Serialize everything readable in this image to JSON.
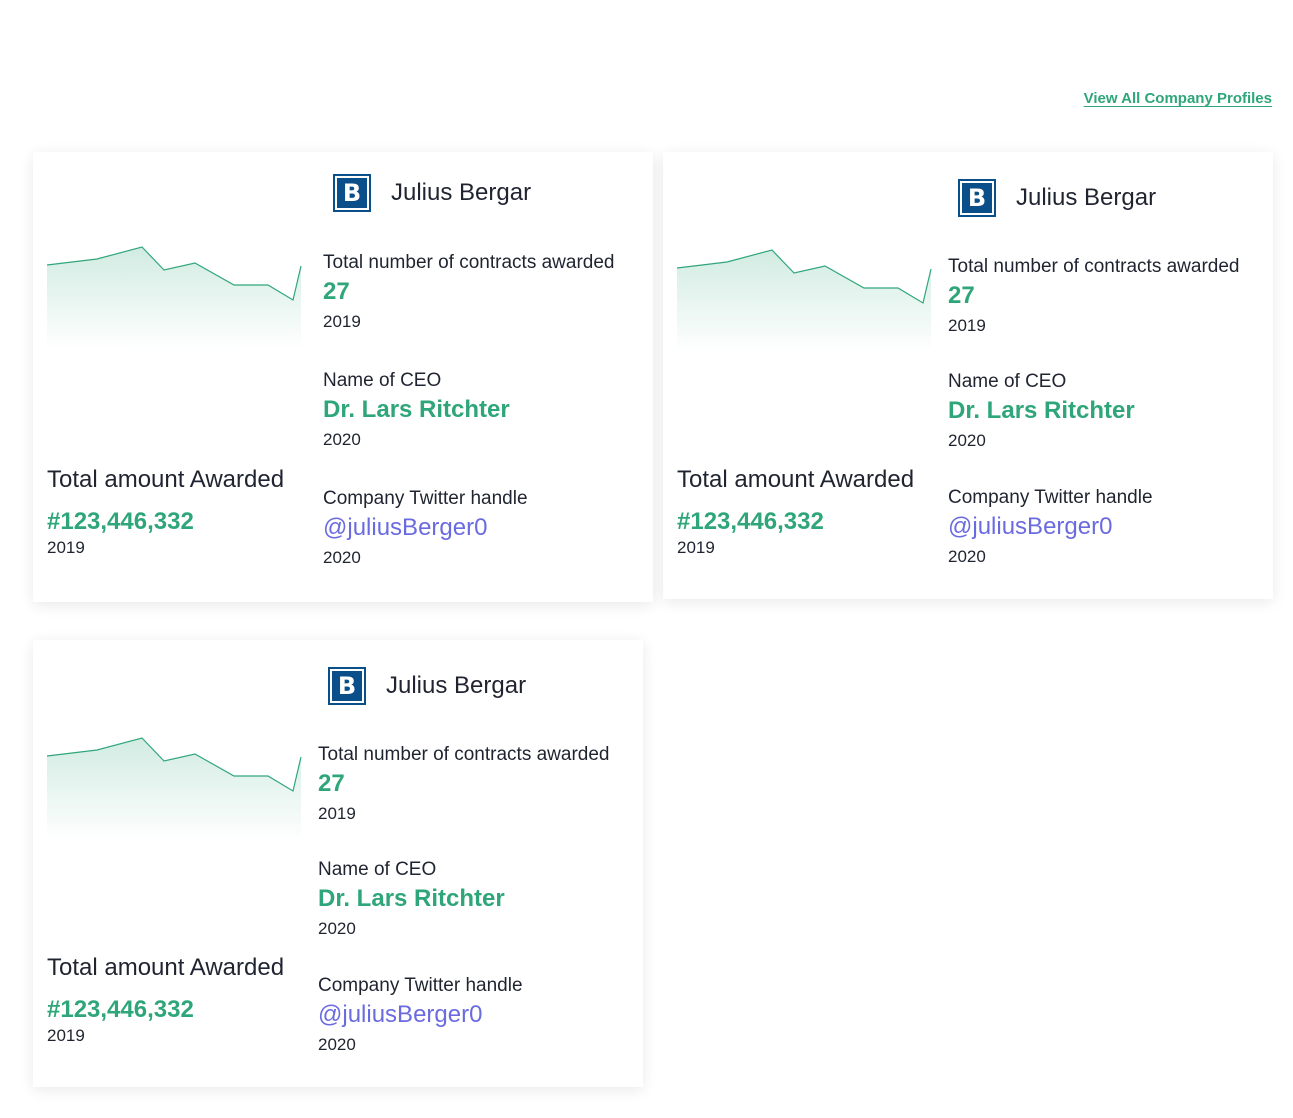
{
  "header": {
    "view_all_label": "View All Company Profiles"
  },
  "colors": {
    "accent_green": "#2fa67a",
    "twitter_purple": "#6b6be0",
    "logo_blue": "#0b4f8a"
  },
  "cards": [
    {
      "logo_letter": "B",
      "company_name": "Julius Bergar",
      "contracts_label": "Total number of contracts awarded",
      "contracts_value": "27",
      "contracts_year": "2019",
      "ceo_label": "Name of CEO",
      "ceo_value": "Dr. Lars Ritchter",
      "ceo_year": "2020",
      "twitter_label": "Company Twitter handle",
      "twitter_value": "@juliusBerger0",
      "twitter_year": "2020",
      "amount_label": "Total amount Awarded",
      "amount_value": "#123,446,332",
      "amount_year": "2019",
      "trend_icon": "sparkline-area-chart"
    },
    {
      "logo_letter": "B",
      "company_name": "Julius Bergar",
      "contracts_label": "Total number of contracts awarded",
      "contracts_value": "27",
      "contracts_year": "2019",
      "ceo_label": "Name of CEO",
      "ceo_value": "Dr. Lars Ritchter",
      "ceo_year": "2020",
      "twitter_label": "Company Twitter handle",
      "twitter_value": "@juliusBerger0",
      "twitter_year": "2020",
      "amount_label": "Total amount Awarded",
      "amount_value": "#123,446,332",
      "amount_year": "2019",
      "trend_icon": "sparkline-area-chart"
    },
    {
      "logo_letter": "B",
      "company_name": "Julius Bergar",
      "contracts_label": "Total number of contracts awarded",
      "contracts_value": "27",
      "contracts_year": "2019",
      "ceo_label": "Name of CEO",
      "ceo_value": "Dr. Lars Ritchter",
      "ceo_year": "2020",
      "twitter_label": "Company Twitter handle",
      "twitter_value": "@juliusBerger0",
      "twitter_year": "2020",
      "amount_label": "Total amount Awarded",
      "amount_value": "#123,446,332",
      "amount_year": "2019",
      "trend_icon": "sparkline-area-chart"
    }
  ]
}
